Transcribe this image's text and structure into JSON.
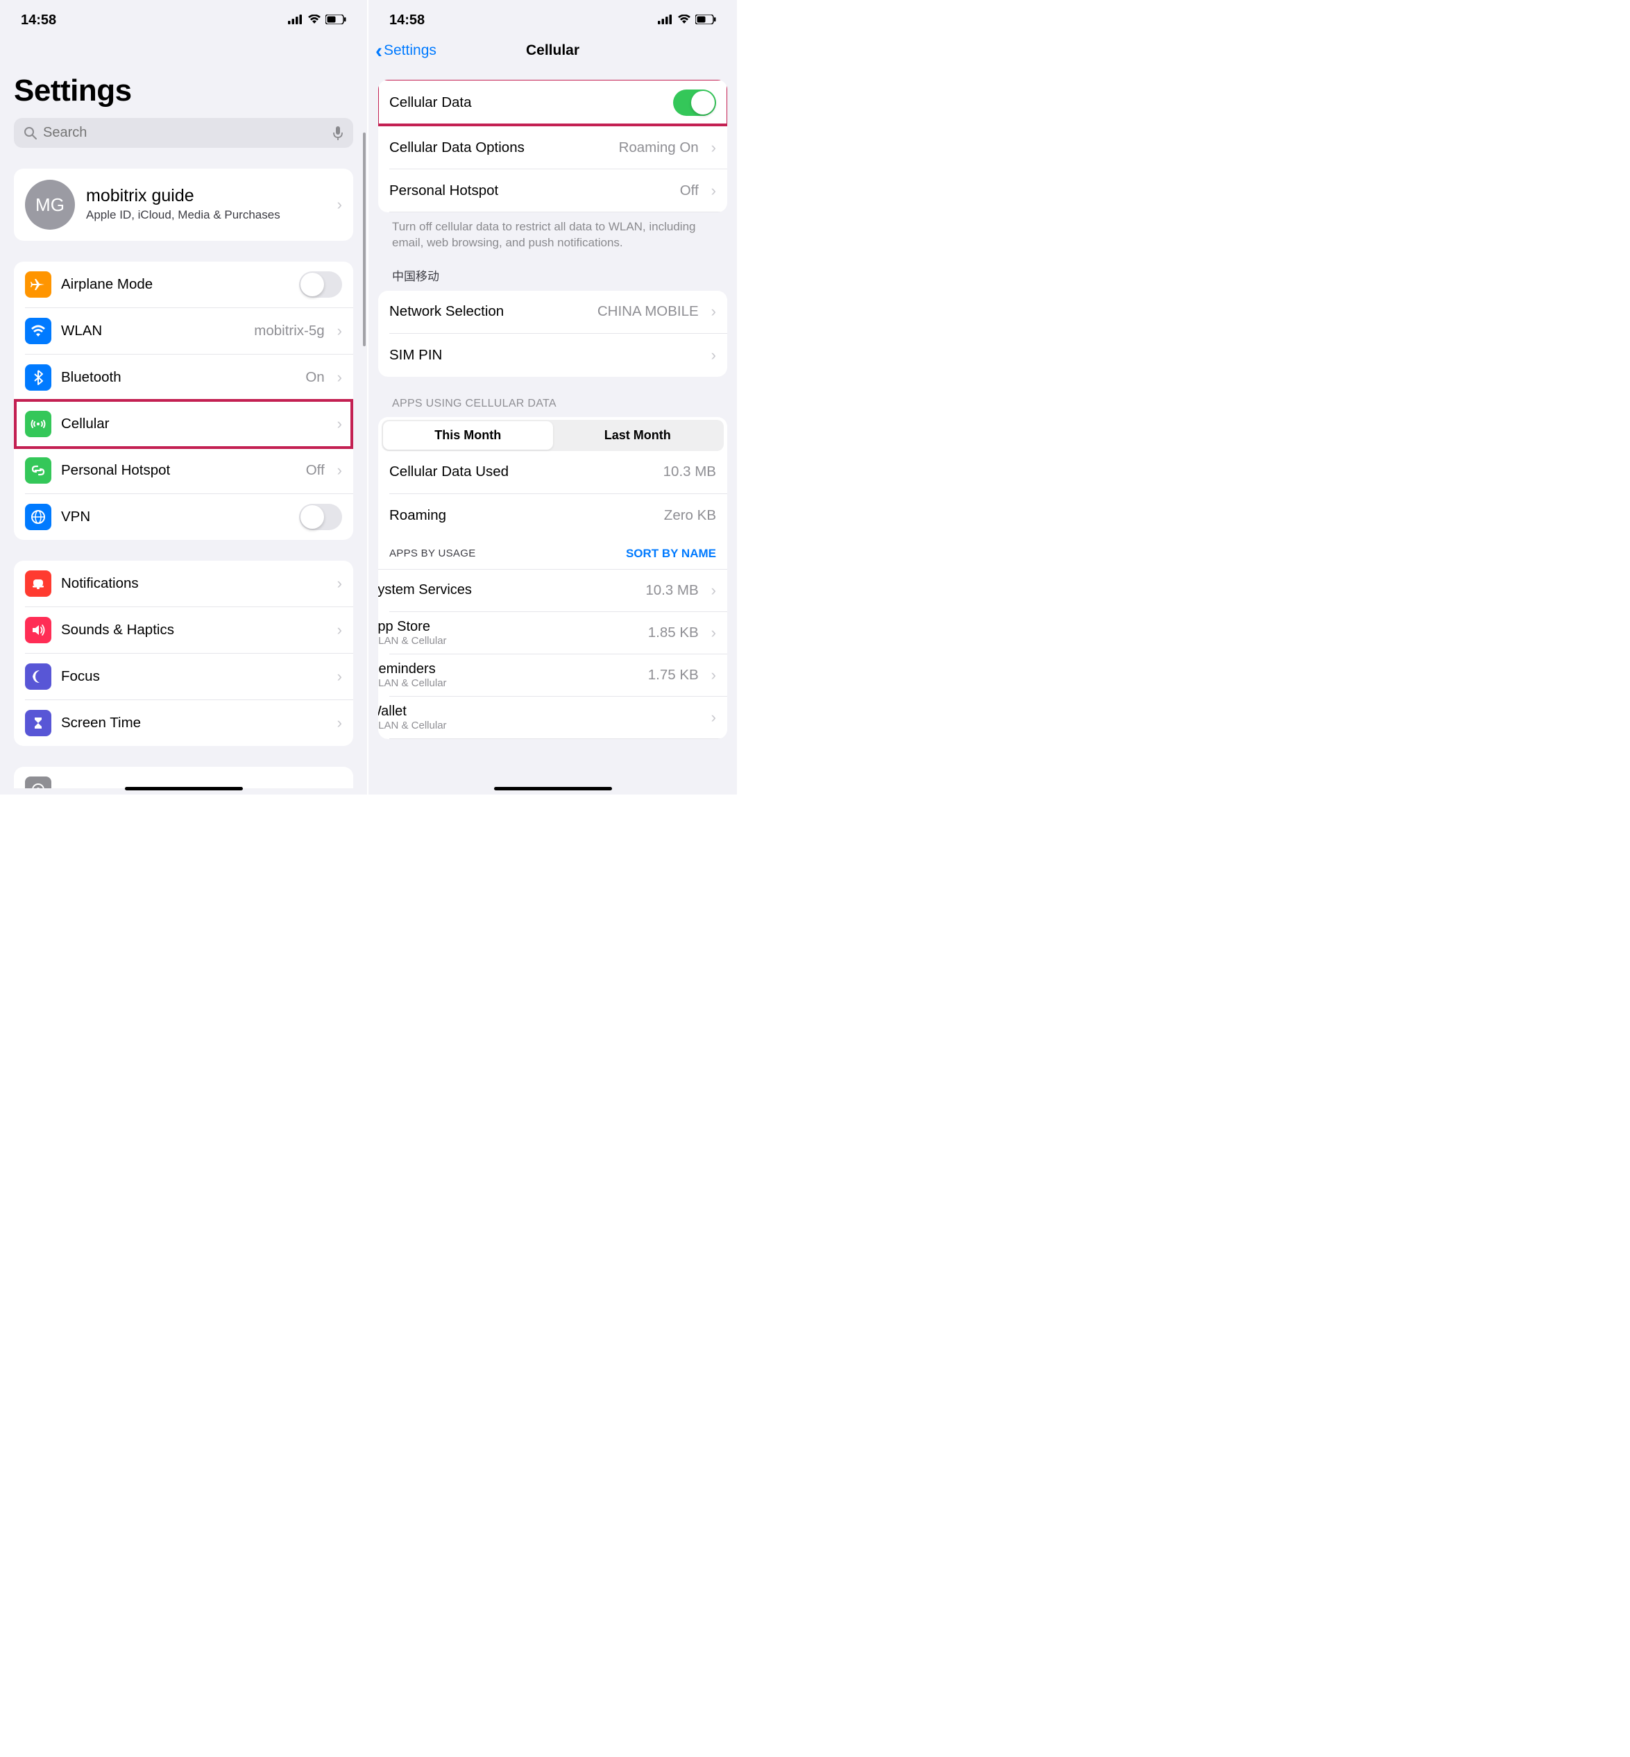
{
  "statusbar": {
    "time": "14:58"
  },
  "left": {
    "title": "Settings",
    "search_placeholder": "Search",
    "apple_id": {
      "initials": "MG",
      "name": "mobitrix guide",
      "subtitle": "Apple ID, iCloud, Media & Purchases"
    },
    "group1": [
      {
        "icon": "airplane",
        "color": "#ff9500",
        "label": "Airplane Mode",
        "toggle": false
      },
      {
        "icon": "wifi",
        "color": "#007aff",
        "label": "WLAN",
        "value": "mobitrix-5g",
        "chevron": true
      },
      {
        "icon": "bluetooth",
        "color": "#007aff",
        "label": "Bluetooth",
        "value": "On",
        "chevron": true
      },
      {
        "icon": "antenna",
        "color": "#34c759",
        "label": "Cellular",
        "chevron": true,
        "highlight": true
      },
      {
        "icon": "link",
        "color": "#34c759",
        "label": "Personal Hotspot",
        "value": "Off",
        "chevron": true
      },
      {
        "icon": "globe",
        "color": "#007aff",
        "label": "VPN",
        "toggle": false
      }
    ],
    "group2": [
      {
        "icon": "bell",
        "color": "#ff3b30",
        "label": "Notifications",
        "chevron": true
      },
      {
        "icon": "speaker",
        "color": "#ff2d55",
        "label": "Sounds & Haptics",
        "chevron": true
      },
      {
        "icon": "moon",
        "color": "#5856d6",
        "label": "Focus",
        "chevron": true
      },
      {
        "icon": "hourglass",
        "color": "#5856d6",
        "label": "Screen Time",
        "chevron": true
      }
    ]
  },
  "right": {
    "back": "Settings",
    "title": "Cellular",
    "top_rows": [
      {
        "label": "Cellular Data",
        "toggle": true,
        "highlight": true
      },
      {
        "label": "Cellular Data Options",
        "value": "Roaming On",
        "chevron": true
      },
      {
        "label": "Personal Hotspot",
        "value": "Off",
        "chevron": true
      }
    ],
    "footer1": "Turn off cellular data to restrict all data to WLAN, including email, web browsing, and push notifications.",
    "carrier_header": "中国移动",
    "carrier_rows": [
      {
        "label": "Network Selection",
        "value": "CHINA MOBILE",
        "chevron": true
      },
      {
        "label": "SIM PIN",
        "chevron": true
      }
    ],
    "apps_header": "APPS USING CELLULAR DATA",
    "segments": [
      "This Month",
      "Last Month"
    ],
    "active_segment": 0,
    "usage_rows": [
      {
        "label": "Cellular Data Used",
        "value": "10.3 MB"
      },
      {
        "label": "Roaming",
        "value": "Zero KB"
      }
    ],
    "apps_subheader": "APPS BY USAGE",
    "sort_link": "SORT BY NAME",
    "apps": [
      {
        "icon": "gear",
        "color": "#8e8e93",
        "label": "System Services",
        "value": "10.3 MB",
        "chevron": true
      },
      {
        "icon": "appstore",
        "color": "#1d96f3",
        "label": "App Store",
        "sub": "WLAN & Cellular",
        "value": "1.85 KB",
        "chevron": true
      },
      {
        "icon": "reminders",
        "color": "#fff",
        "label": "Reminders",
        "sub": "WLAN & Cellular",
        "value": "1.75 KB",
        "chevron": true
      },
      {
        "icon": "wallet",
        "color": "#000",
        "label": "Wallet",
        "sub": "WLAN & Cellular",
        "value": "",
        "chevron": true
      }
    ]
  }
}
